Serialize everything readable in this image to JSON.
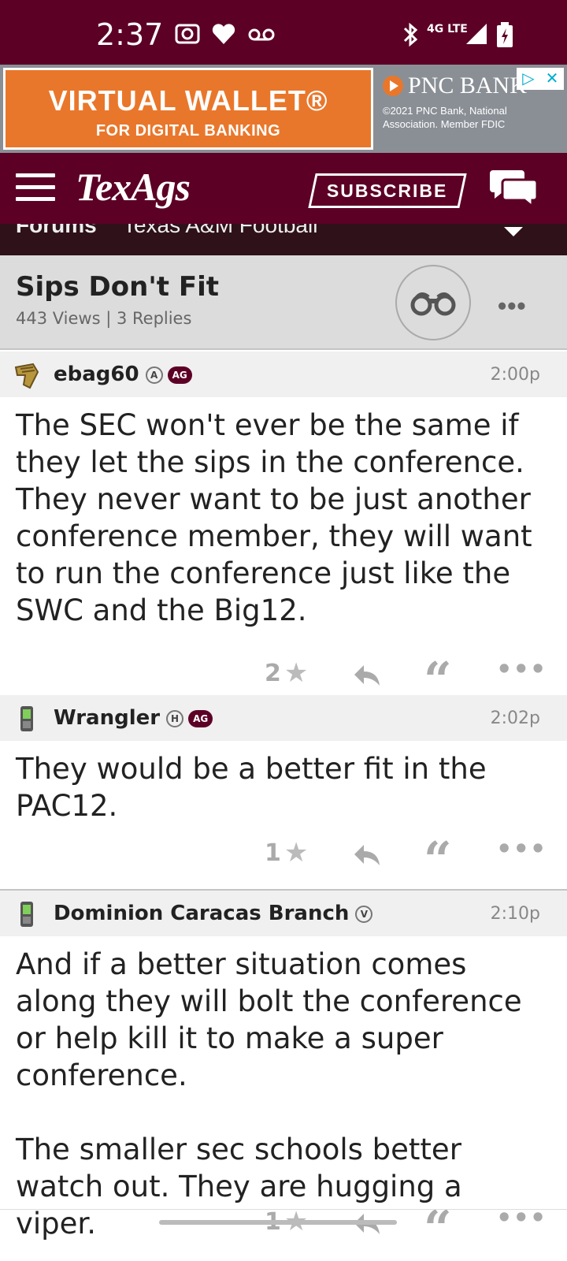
{
  "status_bar": {
    "time": "2:37",
    "network": "4G LTE"
  },
  "ad": {
    "title": "VIRTUAL WALLET®",
    "subtitle": "FOR DIGITAL BANKING",
    "brand": "PNC BANK",
    "fine_print_1": "©2021 PNC Bank, National",
    "fine_print_2": "Association. Member FDIC"
  },
  "header": {
    "logo": "TexAgs",
    "subscribe_label": "SUBSCRIBE"
  },
  "breadcrumb": {
    "forums": "Forums",
    "board": "Texas A&M Football"
  },
  "thread": {
    "title": "Sips Don't Fit",
    "stats": "443 Views | 3 Replies"
  },
  "posts": [
    {
      "username": "ebag60",
      "badge": "A",
      "ag_badge": "AG",
      "time": "2:00p",
      "body": "The SEC won't ever be the same if they let the sips in the conference. They never want to be just another conference member, they will want to run the conference just like the SWC and the Big12.",
      "stars": "2"
    },
    {
      "username": "Wrangler",
      "badge": "H",
      "ag_badge": "AG",
      "time": "2:02p",
      "body": "They would be a better fit in the PAC12.",
      "stars": "1"
    },
    {
      "username": "Dominion Caracas Branch",
      "badge": "V",
      "time": "2:10p",
      "body": "And if a better situation comes along they will bolt the conference or help kill it to make a super conference.\n\nThe smaller sec schools better watch out. They are hugging a viper.",
      "stars": "1"
    }
  ],
  "icons": {
    "more": "•••",
    "star": "★",
    "quote": "“"
  },
  "colors": {
    "maroon": "#5c0025",
    "ad_orange": "#e9772b"
  }
}
